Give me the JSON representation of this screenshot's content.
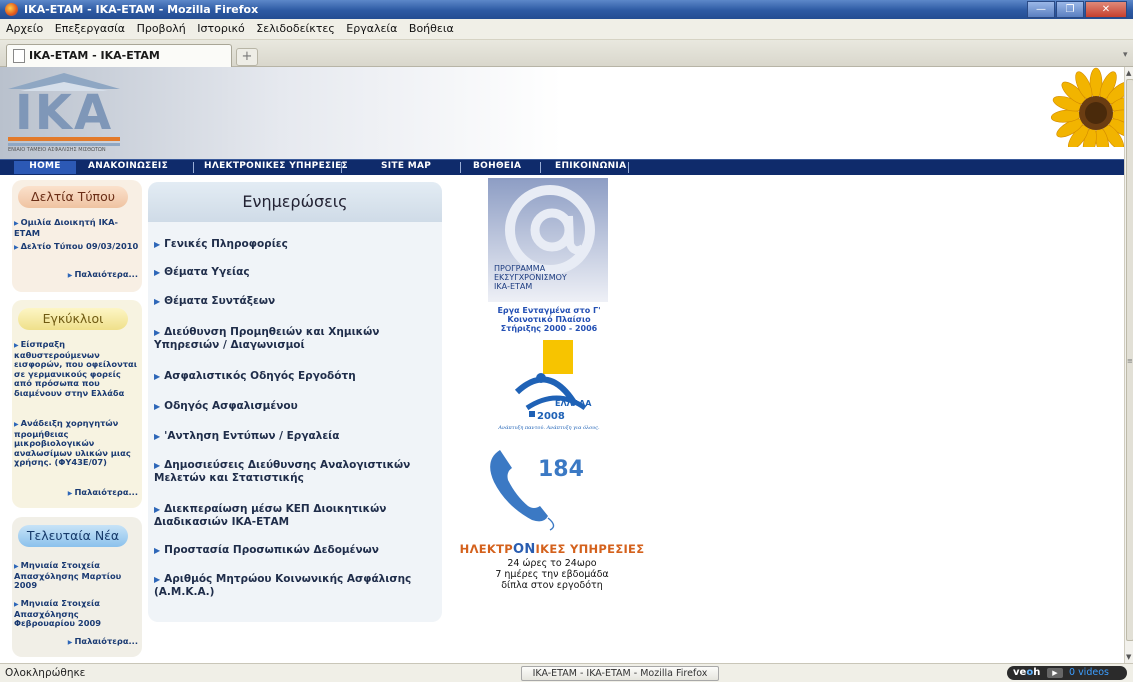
{
  "window": {
    "title": "IKA-ETAM - IKA-ETAM - Mozilla Firefox"
  },
  "menubar": [
    "Αρχείο",
    "Επεξεργασία",
    "Προβολή",
    "Ιστορικό",
    "Σελιδοδείκτες",
    "Εργαλεία",
    "Βοήθεια"
  ],
  "tab": {
    "label": "IKA-ETAM - IKA-ETAM",
    "new_tab": "+"
  },
  "logo": {
    "text": "IKA",
    "subtitle": "ΕΝΙΑΙΟ ΤΑΜΕΙΟ ΑΣΦΑΛΙΣΗΣ ΜΙΣΘΩΤΩΝ"
  },
  "nav": [
    "HOME",
    "ΑΝΑΚΟΙΝΩΣΕΙΣ",
    "ΗΛΕΚΤΡΟΝΙΚΕΣ ΥΠΗΡΕΣΙΕΣ",
    "SITE MAP",
    "ΒΟΗΘΕΙΑ",
    "ΕΠΙΚΟΙΝΩΝΙΑ"
  ],
  "press": {
    "title": "Δελτία Τύπου",
    "items": [
      "Ομιλία Διοικητή ΙΚΑ-ΕΤΑΜ",
      "Δελτίο Τύπου 09/03/2010"
    ],
    "more": "Παλαιότερα..."
  },
  "circulars": {
    "title": "Εγκύκλιοι",
    "items": [
      "Είσπραξη καθυστερούμενων εισφορών, που οφείλονται σε γερμανικούς φορείς από πρόσωπα που διαμένουν στην Ελλάδα",
      "Ανάδειξη χορηγητών προμήθειας μικροβιολογικών αναλωσίμων υλικών μιας χρήσης. (ΦΥ43Ε/07)"
    ],
    "more": "Παλαιότερα..."
  },
  "news": {
    "title": "Τελευταία Νέα",
    "items": [
      "Μηνιαία Στοιχεία Απασχόλησης Μαρτίου 2009",
      "Μηνιαία Στοιχεία Απασχόλησης Φεβρουαρίου 2009"
    ],
    "more": "Παλαιότερα..."
  },
  "updates": {
    "title": "Ενημερώσεις",
    "items": [
      "Γενικές Πληροφορίες",
      "Θέματα Υγείας",
      "Θέματα Συντάξεων",
      "Διεύθυνση Προμηθειών και Χημικών Υπηρεσιών / Διαγωνισμοί",
      "Ασφαλιστικός Οδηγός Εργοδότη",
      "Οδηγός Ασφαλισμένου",
      "'Αντληση Εντύπων / Εργαλεία",
      "Δημοσιεύσεις Διεύθυνσης Αναλογιστικών Μελετών και Στατιστικής",
      "Διεκπεραίωση μέσω ΚΕΠ Διοικητικών Διαδικασιών ΙΚΑ-ΕΤΑΜ",
      "Προστασία Προσωπικών Δεδομένων",
      "Αριθμός Μητρώου Κοινωνικής Ασφάλισης (Α.Μ.Κ.Α.)"
    ]
  },
  "banners": {
    "modernization": [
      "ΠΡΟΓΡΑΜΜΑ",
      "ΕΚΣΥΓΧΡΟΝΙΣΜΟΥ",
      "ΙΚΑ-ΕΤΑΜ"
    ],
    "eu": "Εργα Ενταγμένα στο Γ' Κοινοτικό Πλαίσιο Στήριξης 2000 - 2006",
    "greece": {
      "name": "ΕΛΛΑΔΑ",
      "year": "2008",
      "slogan": "Ανάπτυξη παντού. Ανάπτυξη για όλους."
    },
    "phone": "184",
    "eservices": {
      "title_pre": "ΗΛΕΚΤΡ",
      "title_hi": "ΟΝ",
      "title_post": "ΙΚΕΣ ΥΠΗΡΕΣΙΕΣ",
      "lines": [
        "24 ώρες το 24ωρο",
        "7 ημέρες την εβδομάδα",
        "δίπλα στον εργοδότη"
      ]
    }
  },
  "statusbar": {
    "status": "Ολοκληρώθηκε",
    "task": "IKA-ETAM - IKA-ETAM - Mozilla Firefox",
    "veoh_videos": "0 videos"
  },
  "colors": {
    "navbar": "#0f2b6b",
    "accent_orange": "#d4611c",
    "link_blue": "#1b3b73"
  }
}
